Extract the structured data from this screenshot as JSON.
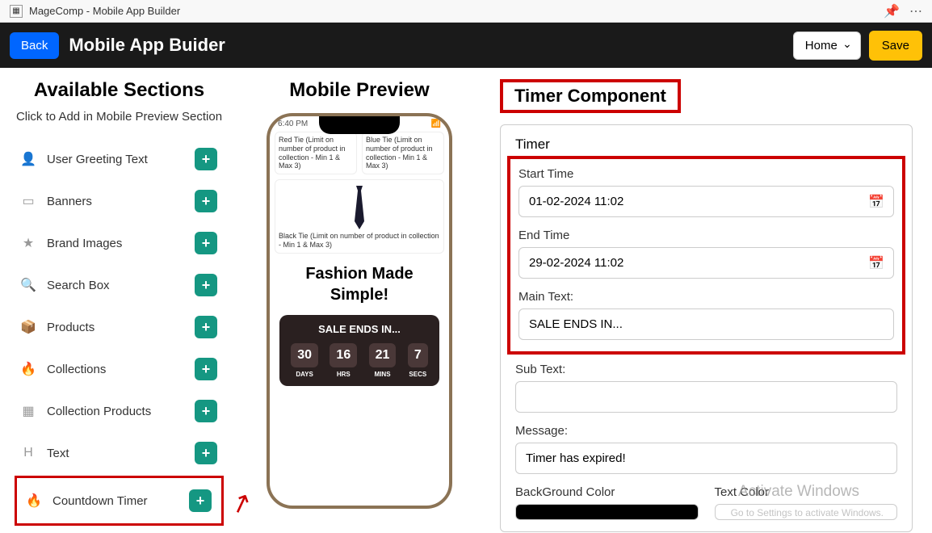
{
  "topBar": {
    "appName": "MageComp - Mobile App Builder",
    "pinIcon": "⚲",
    "moreIcon": "⋯"
  },
  "header": {
    "backLabel": "Back",
    "title": "Mobile App Buider",
    "homeLabel": "Home",
    "saveLabel": "Save"
  },
  "sidebar": {
    "title": "Available Sections",
    "subtitle": "Click to Add in Mobile Preview Section",
    "items": [
      {
        "icon": "user",
        "label": "User Greeting Text"
      },
      {
        "icon": "banner",
        "label": "Banners"
      },
      {
        "icon": "star",
        "label": "Brand Images"
      },
      {
        "icon": "search",
        "label": "Search Box"
      },
      {
        "icon": "box",
        "label": "Products"
      },
      {
        "icon": "flame",
        "label": "Collections"
      },
      {
        "icon": "grid",
        "label": "Collection Products"
      },
      {
        "icon": "H",
        "label": "Text"
      },
      {
        "icon": "flame",
        "label": "Countdown Timer"
      }
    ]
  },
  "preview": {
    "title": "Mobile Preview",
    "statusTime": "6:40 PM",
    "products": {
      "p1": "Red Tie (Limit on number of product in collection - Min 1 & Max 3)",
      "p2": "Blue Tie (Limit on number of product in collection - Min 1 & Max 3)",
      "p3": "Black Tie (Limit on number of product in collection - Min 1 & Max 3)"
    },
    "tagline": "Fashion Made Simple!",
    "timer": {
      "text": "SALE ENDS IN...",
      "days": "30",
      "daysLabel": "DAYS",
      "hrs": "16",
      "hrsLabel": "HRS",
      "mins": "21",
      "minsLabel": "MINS",
      "secs": "7",
      "secsLabel": "SECS"
    }
  },
  "config": {
    "title": "Timer Component",
    "heading": "Timer",
    "startTimeLabel": "Start Time",
    "startTimeValue": "01-02-2024 11:02",
    "endTimeLabel": "End Time",
    "endTimeValue": "29-02-2024 11:02",
    "mainTextLabel": "Main Text:",
    "mainTextValue": "SALE ENDS IN...",
    "subTextLabel": "Sub Text:",
    "subTextValue": "",
    "messageLabel": "Message:",
    "messageValue": "Timer has expired!",
    "bgColorLabel": "BackGround Color",
    "bgColorValue": "#000000",
    "textColorLabel": "Text Color",
    "textColorValue": "#ffffff"
  },
  "watermark": {
    "title": "Activate Windows",
    "sub": "Go to Settings to activate Windows."
  }
}
